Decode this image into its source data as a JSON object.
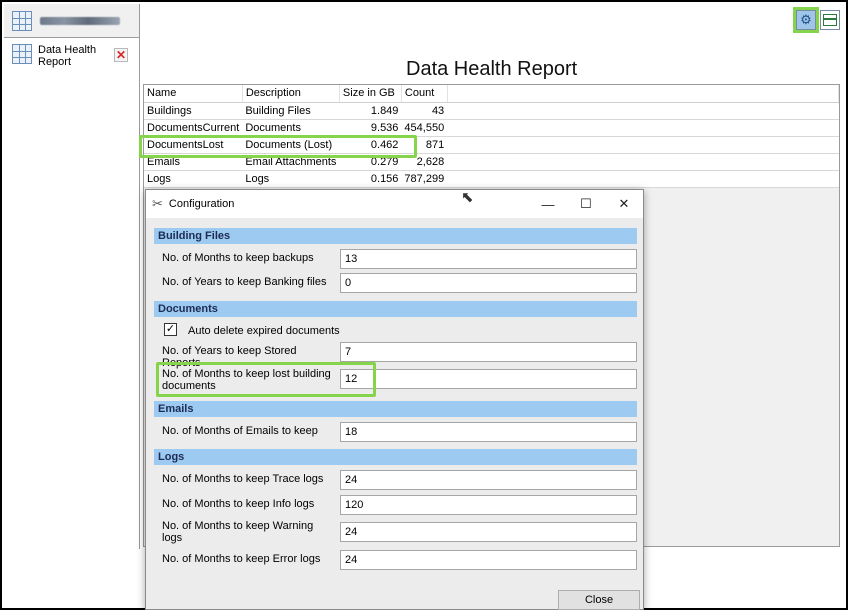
{
  "sidebar": {
    "report_label": "Data Health Report"
  },
  "main": {
    "title": "Data Health Report",
    "table": {
      "columns": [
        "Name",
        "Description",
        "Size in GB",
        "Count"
      ],
      "rows": [
        {
          "name": "Buildings",
          "description": "Building Files",
          "size": "1.849",
          "count": "43"
        },
        {
          "name": "DocumentsCurrent",
          "description": "Documents",
          "size": "9.536",
          "count": "454,550"
        },
        {
          "name": "DocumentsLost",
          "description": "Documents (Lost)",
          "size": "0.462",
          "count": "871"
        },
        {
          "name": "Emails",
          "description": "Email Attachments",
          "size": "0.279",
          "count": "2,628"
        },
        {
          "name": "Logs",
          "description": "Logs",
          "size": "0.156",
          "count": "787,299"
        }
      ]
    }
  },
  "dialog": {
    "title": "Configuration",
    "controls": {
      "minimize": "—",
      "maximize": "☐",
      "close": "✕"
    },
    "sections": {
      "building_files": {
        "header": "Building Files",
        "months_backups_label": "No. of Months to keep backups",
        "months_backups_value": "13",
        "years_banking_label": "No. of Years to keep Banking files",
        "years_banking_value": "0"
      },
      "documents": {
        "header": "Documents",
        "auto_delete_label": "Auto delete expired documents",
        "auto_delete_checked": true,
        "years_reports_label": "No. of Years to keep Stored Reports",
        "years_reports_value": "7",
        "months_lost_label": "No. of Months to keep lost building documents",
        "months_lost_value": "12"
      },
      "emails": {
        "header": "Emails",
        "months_emails_label": "No. of Months of Emails to keep",
        "months_emails_value": "18"
      },
      "logs": {
        "header": "Logs",
        "trace_label": "No. of Months to keep Trace logs",
        "trace_value": "24",
        "info_label": "No. of Months to keep Info logs",
        "info_value": "120",
        "warning_label": "No. of Months to keep Warning logs",
        "warning_value": "24",
        "error_label": "No. of Months to keep Error logs",
        "error_value": "24"
      }
    },
    "close_label": "Close"
  },
  "colors": {
    "highlight": "#86d34c",
    "section_header": "#9ccaf0",
    "section_text": "#1d2b55"
  },
  "icons": {
    "toolbar": [
      "settings-gear-icon",
      "panel-icon"
    ],
    "sidebar": [
      "grid-icon",
      "remove-icon"
    ],
    "dialog": [
      "tools-icon",
      "cursor-icon"
    ]
  }
}
